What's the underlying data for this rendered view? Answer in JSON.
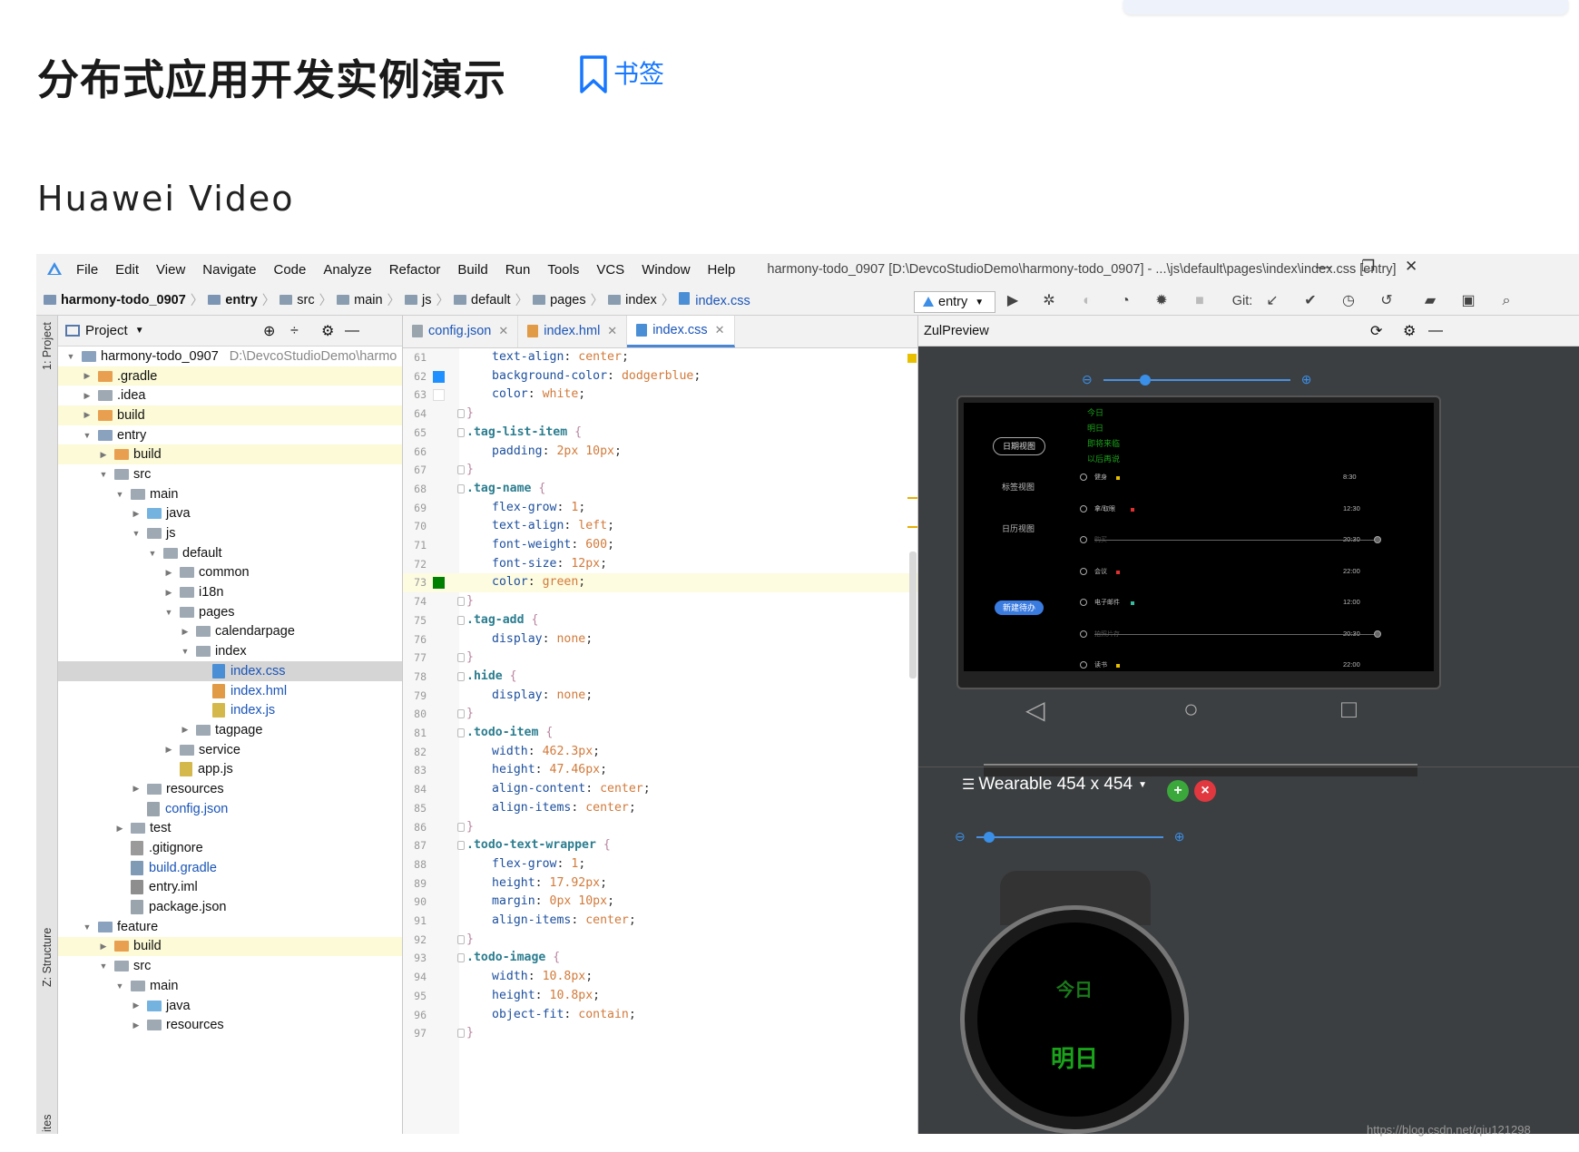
{
  "article": {
    "title": "分布式应用开发实例演示",
    "bookmark_label": "书签",
    "subtitle": "Huawei Video",
    "watermark": "https://blog.csdn.net/qiu121298"
  },
  "ide": {
    "menu": [
      "File",
      "Edit",
      "View",
      "Navigate",
      "Code",
      "Analyze",
      "Refactor",
      "Build",
      "Run",
      "Tools",
      "VCS",
      "Window",
      "Help"
    ],
    "window_title": "harmony-todo_0907 [D:\\DevcoStudioDemo\\harmony-todo_0907] - ...\\js\\default\\pages\\index\\index.css [entry]",
    "window_controls": [
      "—",
      "❐",
      "✕"
    ],
    "breadcrumb": [
      "harmony-todo_0907",
      "entry",
      "src",
      "main",
      "js",
      "default",
      "pages",
      "index",
      "index.css"
    ],
    "run_config": "entry",
    "git_label": "Git:",
    "side_tabs": {
      "project": "1: Project",
      "structure": "Z: Structure",
      "favorites": "ites"
    },
    "project_panel": {
      "title": "Project",
      "tree": [
        {
          "label": "harmony-todo_0907",
          "path": "D:\\DevcoStudioDemo\\harmo",
          "depth": 0,
          "expanded": true,
          "icon": "module"
        },
        {
          "label": ".gradle",
          "depth": 1,
          "expanded": false,
          "icon": "orange",
          "highlight": true
        },
        {
          "label": ".idea",
          "depth": 1,
          "expanded": false,
          "icon": "gray"
        },
        {
          "label": "build",
          "depth": 1,
          "expanded": false,
          "icon": "orange",
          "highlight": true
        },
        {
          "label": "entry",
          "depth": 1,
          "expanded": true,
          "icon": "module"
        },
        {
          "label": "build",
          "depth": 2,
          "expanded": false,
          "icon": "orange",
          "highlight": true
        },
        {
          "label": "src",
          "depth": 2,
          "expanded": true,
          "icon": "gray"
        },
        {
          "label": "main",
          "depth": 3,
          "expanded": true,
          "icon": "gray"
        },
        {
          "label": "java",
          "depth": 4,
          "expanded": false,
          "icon": "blue"
        },
        {
          "label": "js",
          "depth": 4,
          "expanded": true,
          "icon": "gray"
        },
        {
          "label": "default",
          "depth": 5,
          "expanded": true,
          "icon": "gray"
        },
        {
          "label": "common",
          "depth": 6,
          "expanded": false,
          "icon": "gray"
        },
        {
          "label": "i18n",
          "depth": 6,
          "expanded": false,
          "icon": "gray"
        },
        {
          "label": "pages",
          "depth": 6,
          "expanded": true,
          "icon": "gray"
        },
        {
          "label": "calendarpage",
          "depth": 7,
          "expanded": false,
          "icon": "gray"
        },
        {
          "label": "index",
          "depth": 7,
          "expanded": true,
          "icon": "gray"
        },
        {
          "label": "index.css",
          "depth": 8,
          "file": "css",
          "selected": true
        },
        {
          "label": "index.hml",
          "depth": 8,
          "file": "hml"
        },
        {
          "label": "index.js",
          "depth": 8,
          "file": "js"
        },
        {
          "label": "tagpage",
          "depth": 7,
          "expanded": false,
          "icon": "gray"
        },
        {
          "label": "service",
          "depth": 6,
          "expanded": false,
          "icon": "gray"
        },
        {
          "label": "app.js",
          "depth": 6,
          "file": "js",
          "plain": true
        },
        {
          "label": "resources",
          "depth": 4,
          "expanded": false,
          "icon": "gray"
        },
        {
          "label": "config.json",
          "depth": 4,
          "file": "json"
        },
        {
          "label": "test",
          "depth": 3,
          "expanded": false,
          "icon": "gray"
        },
        {
          "label": ".gitignore",
          "depth": 3,
          "file": "git",
          "plain": true
        },
        {
          "label": "build.gradle",
          "depth": 3,
          "file": "gradle"
        },
        {
          "label": "entry.iml",
          "depth": 3,
          "file": "iml",
          "plain": true
        },
        {
          "label": "package.json",
          "depth": 3,
          "file": "json",
          "plain": true
        },
        {
          "label": "feature",
          "depth": 1,
          "expanded": true,
          "icon": "module"
        },
        {
          "label": "build",
          "depth": 2,
          "expanded": false,
          "icon": "orange",
          "highlight": true
        },
        {
          "label": "src",
          "depth": 2,
          "expanded": true,
          "icon": "gray"
        },
        {
          "label": "main",
          "depth": 3,
          "expanded": true,
          "icon": "gray"
        },
        {
          "label": "java",
          "depth": 4,
          "expanded": false,
          "icon": "blue"
        },
        {
          "label": "resources",
          "depth": 4,
          "expanded": false,
          "icon": "gray"
        }
      ]
    },
    "editor": {
      "tabs": [
        {
          "label": "config.json",
          "icon": "json",
          "active": false
        },
        {
          "label": "index.hml",
          "icon": "hml",
          "active": false
        },
        {
          "label": "index.css",
          "icon": "css",
          "active": true
        }
      ],
      "current_line": 73,
      "lines": [
        {
          "n": 61,
          "indent": 1,
          "prop": "text-align",
          "val": "center"
        },
        {
          "n": 62,
          "indent": 1,
          "prop": "background-color",
          "val": "dodgerblue",
          "swatch": "#1e90ff"
        },
        {
          "n": 63,
          "indent": 1,
          "prop": "color",
          "val": "white",
          "swatch": "#ffffff"
        },
        {
          "n": 64,
          "close": true
        },
        {
          "n": 65,
          "selector": ".tag-list-item"
        },
        {
          "n": 66,
          "indent": 1,
          "prop": "padding",
          "val": "2px 10px"
        },
        {
          "n": 67,
          "close": true
        },
        {
          "n": 68,
          "selector": ".tag-name"
        },
        {
          "n": 69,
          "indent": 1,
          "prop": "flex-grow",
          "val": "1"
        },
        {
          "n": 70,
          "indent": 1,
          "prop": "text-align",
          "val": "left"
        },
        {
          "n": 71,
          "indent": 1,
          "prop": "font-weight",
          "val": "600"
        },
        {
          "n": 72,
          "indent": 1,
          "prop": "font-size",
          "val": "12px"
        },
        {
          "n": 73,
          "indent": 1,
          "prop": "color",
          "val": "green",
          "swatch": "#008000"
        },
        {
          "n": 74,
          "close": true
        },
        {
          "n": 75,
          "selector": ".tag-add"
        },
        {
          "n": 76,
          "indent": 1,
          "prop": "display",
          "val": "none"
        },
        {
          "n": 77,
          "close": true
        },
        {
          "n": 78,
          "selector": ".hide"
        },
        {
          "n": 79,
          "indent": 1,
          "prop": "display",
          "val": "none"
        },
        {
          "n": 80,
          "close": true
        },
        {
          "n": 81,
          "selector": ".todo-item"
        },
        {
          "n": 82,
          "indent": 1,
          "prop": "width",
          "val": "462.3px"
        },
        {
          "n": 83,
          "indent": 1,
          "prop": "height",
          "val": "47.46px"
        },
        {
          "n": 84,
          "indent": 1,
          "prop": "align-content",
          "val": "center"
        },
        {
          "n": 85,
          "indent": 1,
          "prop": "align-items",
          "val": "center"
        },
        {
          "n": 86,
          "close": true
        },
        {
          "n": 87,
          "selector": ".todo-text-wrapper"
        },
        {
          "n": 88,
          "indent": 1,
          "prop": "flex-grow",
          "val": "1"
        },
        {
          "n": 89,
          "indent": 1,
          "prop": "height",
          "val": "17.92px"
        },
        {
          "n": 90,
          "indent": 1,
          "prop": "margin",
          "val": "0px 10px"
        },
        {
          "n": 91,
          "indent": 1,
          "prop": "align-items",
          "val": "center"
        },
        {
          "n": 92,
          "close": true
        },
        {
          "n": 93,
          "selector": ".todo-image"
        },
        {
          "n": 94,
          "indent": 1,
          "prop": "width",
          "val": "10.8px"
        },
        {
          "n": 95,
          "indent": 1,
          "prop": "height",
          "val": "10.8px"
        },
        {
          "n": 96,
          "indent": 1,
          "prop": "object-fit",
          "val": "contain"
        },
        {
          "n": 97,
          "close": true
        }
      ]
    },
    "preview": {
      "title": "ZulPreview",
      "tv": {
        "tags": [
          "今日",
          "明日",
          "即将来临",
          "以后再说"
        ],
        "views": [
          "日期视图",
          "标签视图",
          "日历视图"
        ],
        "new_button": "新建待办",
        "todos": [
          {
            "text": "健身",
            "time": "8:30",
            "done": false,
            "color": "#e8c000"
          },
          {
            "text": "拿/取眼",
            "time": "12:30",
            "done": false,
            "color": "#e03030"
          },
          {
            "text": "购买",
            "time": "20:30",
            "done": true,
            "color": ""
          },
          {
            "text": "会议",
            "time": "22:00",
            "done": false,
            "color": "#e03030"
          },
          {
            "text": "电子邮件",
            "time": "12:00",
            "done": false,
            "color": "#30c0a0"
          },
          {
            "text": "拍照片存",
            "time": "20:30",
            "done": true,
            "color": ""
          },
          {
            "text": "读书",
            "time": "22:00",
            "done": false,
            "color": "#e8c000"
          }
        ]
      },
      "device_selector": "Wearable 454 x 454",
      "watch": {
        "today": "今日",
        "tomorrow": "明日"
      }
    }
  }
}
